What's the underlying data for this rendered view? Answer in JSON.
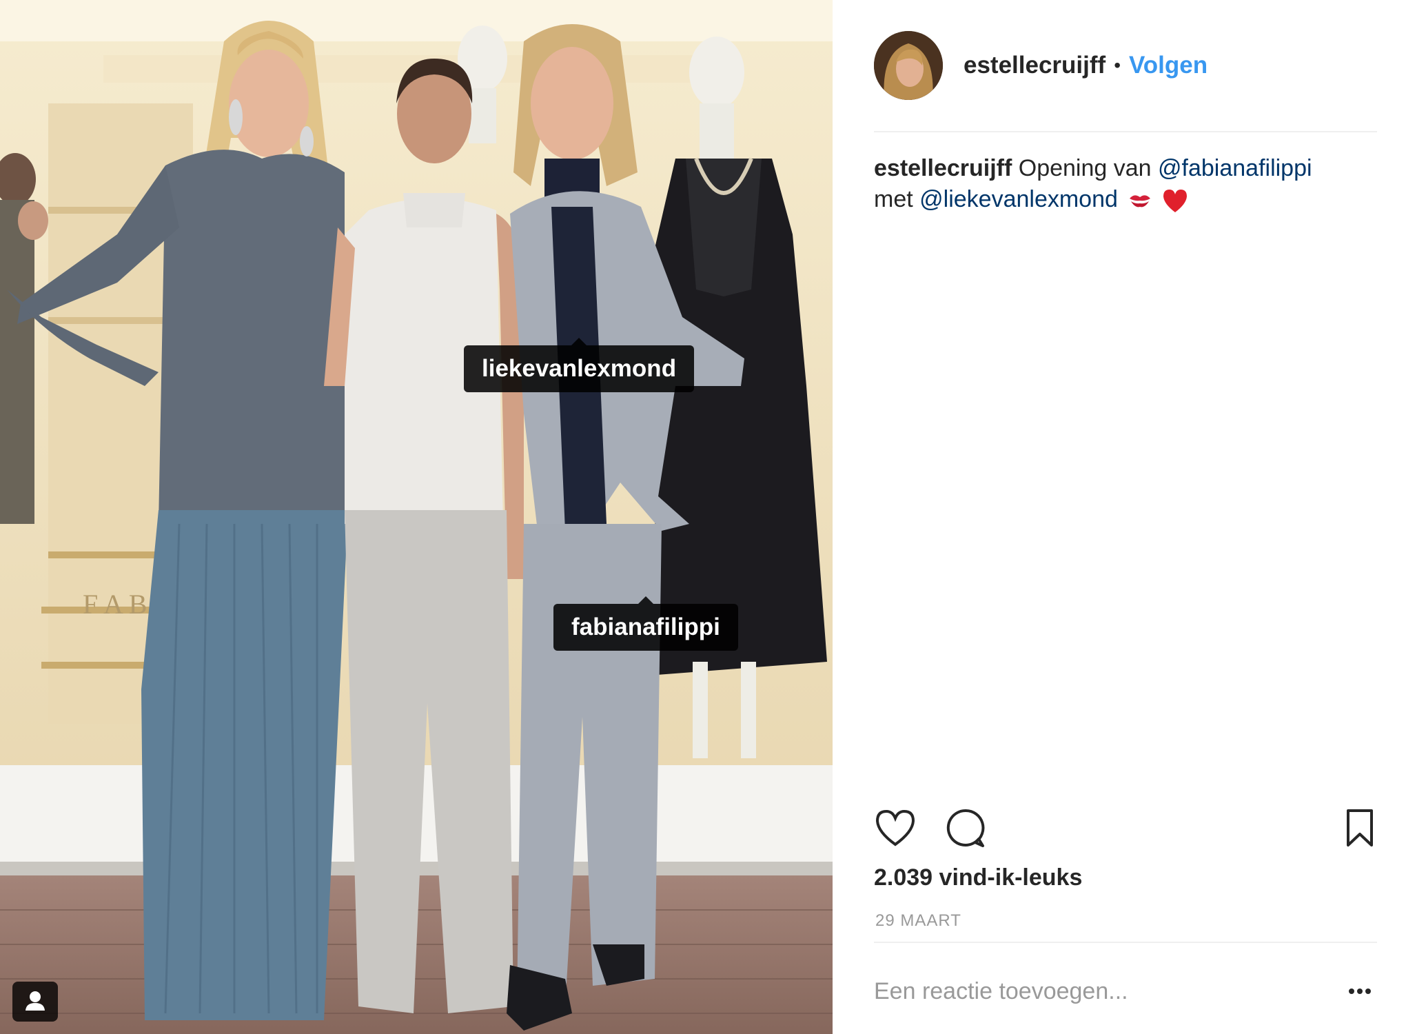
{
  "photo": {
    "tags": [
      {
        "label": "liekevanlexmond"
      },
      {
        "label": "fabianafilippi"
      }
    ],
    "user_tags_icon": "person-icon",
    "sign_text": "F A B"
  },
  "header": {
    "username": "estellecruijff",
    "separator": "•",
    "follow_label": "Volgen",
    "avatar_icon": "profile-avatar"
  },
  "caption": {
    "username": "estellecruijff",
    "text_1": " Opening van ",
    "mention_1": "@fabianafilippi",
    "text_2": "met ",
    "mention_2": "@liekevanlexmond",
    "emojis": [
      "kiss-mark-icon",
      "red-heart-icon"
    ]
  },
  "actions": {
    "icons": [
      "heart-icon",
      "comment-icon",
      "bookmark-icon"
    ]
  },
  "likes_label": "2.039 vind-ik-leuks",
  "date_label": "29 MAART",
  "comment": {
    "placeholder": "Een reactie toevoegen...",
    "more_icon": "more-options-icon"
  },
  "colors": {
    "accent": "#3897f0",
    "mention": "#003569",
    "text": "#262626",
    "muted": "#999999",
    "divider": "#efefef"
  }
}
